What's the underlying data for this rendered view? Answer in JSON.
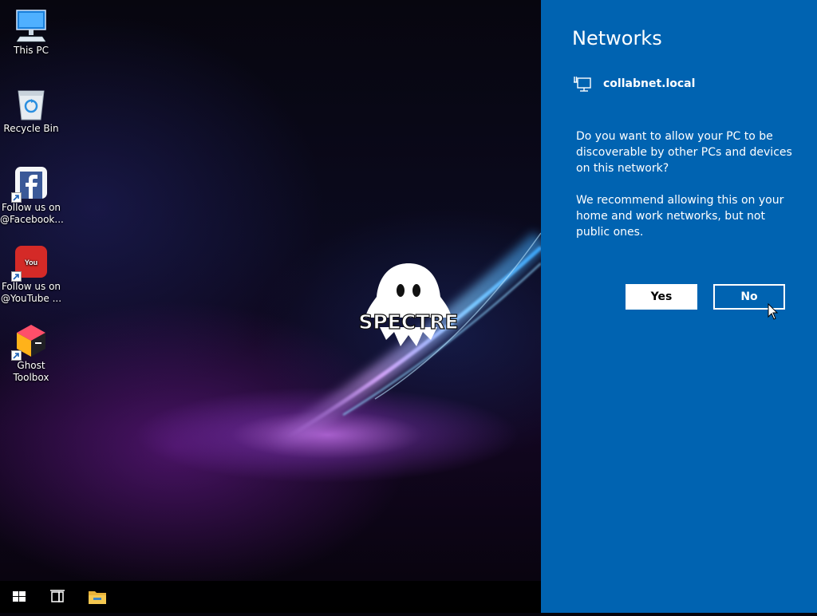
{
  "desktop": {
    "icons": [
      {
        "label_line1": "This PC",
        "label_line2": "",
        "icon": "this-pc-icon"
      },
      {
        "label_line1": "Recycle Bin",
        "label_line2": "",
        "icon": "recycle-bin-icon"
      },
      {
        "label_line1": "Follow us on",
        "label_line2": "@Facebook...",
        "icon": "facebook-icon"
      },
      {
        "label_line1": "Follow us on",
        "label_line2": "@YouTube ...",
        "icon": "youtube-icon"
      },
      {
        "label_line1": "Ghost",
        "label_line2": "Toolbox",
        "icon": "ghost-toolbox-icon"
      }
    ],
    "wallpaper_logo_text": "SPECTRE"
  },
  "taskbar": {
    "items": [
      "start-icon",
      "task-view-icon",
      "file-explorer-icon"
    ]
  },
  "networks_panel": {
    "title": "Networks",
    "network_name": "collabnet.local",
    "network_icon": "ethernet-icon",
    "question": "Do you want to allow your PC to be discoverable by other PCs and devices on this network?",
    "recommendation": "We recommend allowing this on your home and work networks, but not public ones.",
    "yes_label": "Yes",
    "no_label": "No",
    "background_color": "#0063b1"
  }
}
